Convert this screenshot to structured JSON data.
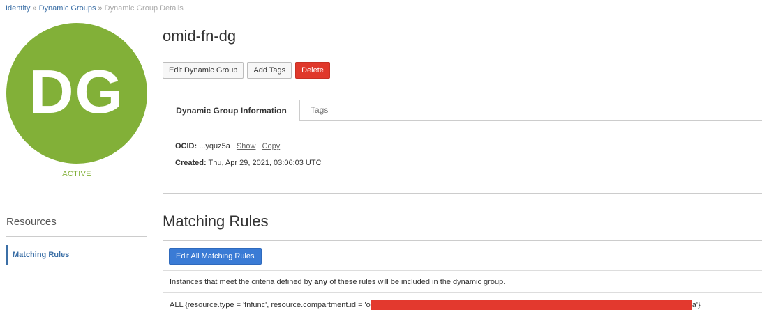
{
  "breadcrumb": {
    "items": [
      "Identity",
      "Dynamic Groups"
    ],
    "separator": "»",
    "current": "Dynamic Group Details"
  },
  "avatar": {
    "initials": "DG",
    "color": "#82b038"
  },
  "status": "ACTIVE",
  "resources": {
    "heading": "Resources",
    "items": [
      {
        "label": "Matching Rules",
        "active": true
      }
    ]
  },
  "group": {
    "name": "omid-fn-dg"
  },
  "actions": {
    "edit_label": "Edit Dynamic Group",
    "tags_label": "Add Tags",
    "delete_label": "Delete"
  },
  "tabs": [
    {
      "label": "Dynamic Group Information",
      "active": true
    },
    {
      "label": "Tags",
      "active": false
    }
  ],
  "info": {
    "ocid_label": "OCID:",
    "ocid_value": "...yquz5a",
    "show_label": "Show",
    "copy_label": "Copy",
    "created_label": "Created:",
    "created_value": "Thu, Apr 29, 2021, 03:06:03 UTC"
  },
  "matching_rules": {
    "title": "Matching Rules",
    "edit_all_label": "Edit All Matching Rules",
    "description_prefix": "Instances that meet the criteria defined by",
    "description_emphasis": "any",
    "description_suffix": "of these rules will be included in the dynamic group.",
    "rules": [
      {
        "prefix": "ALL {resource.type = 'fnfunc', resource.compartment.id = '",
        "redacted_start": "o",
        "redacted_end": "a",
        "suffix": "'}"
      }
    ]
  },
  "colors": {
    "link": "#3b6fa6",
    "danger": "#e0382b",
    "primary": "#3a7bd5",
    "redaction": "#e3392e"
  }
}
